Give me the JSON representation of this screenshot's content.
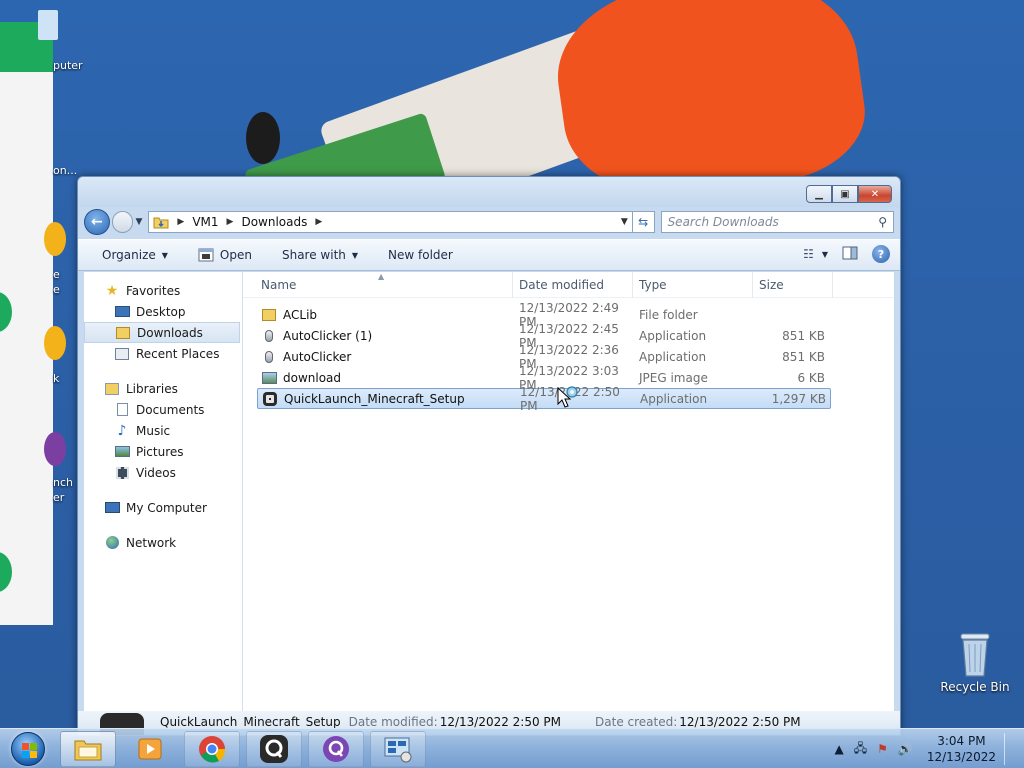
{
  "desktop": {
    "fragments": [
      "puter",
      "on...",
      "e",
      "e",
      "k",
      "nch",
      "er"
    ],
    "recycle_bin_label": "Recycle Bin"
  },
  "window": {
    "address": {
      "crumbs": [
        "VM1",
        "Downloads"
      ]
    },
    "search_placeholder": "Search Downloads",
    "toolbar": {
      "organize": "Organize",
      "open": "Open",
      "share_with": "Share with",
      "new_folder": "New folder"
    },
    "nav": {
      "favorites": {
        "label": "Favorites",
        "items": [
          "Desktop",
          "Downloads",
          "Recent Places"
        ]
      },
      "libraries": {
        "label": "Libraries",
        "items": [
          "Documents",
          "Music",
          "Pictures",
          "Videos"
        ]
      },
      "computer": "My Computer",
      "network": "Network"
    },
    "columns": {
      "name": "Name",
      "date": "Date modified",
      "type": "Type",
      "size": "Size"
    },
    "files": [
      {
        "name": "ACLib",
        "date": "12/13/2022 2:49 PM",
        "type": "File folder",
        "size": "",
        "icon": "folder-icon"
      },
      {
        "name": "AutoClicker (1)",
        "date": "12/13/2022 2:45 PM",
        "type": "Application",
        "size": "851 KB",
        "icon": "mouse-app-icon"
      },
      {
        "name": "AutoClicker",
        "date": "12/13/2022 2:36 PM",
        "type": "Application",
        "size": "851 KB",
        "icon": "mouse-app-icon"
      },
      {
        "name": "download",
        "date": "12/13/2022 3:03 PM",
        "type": "JPEG image",
        "size": "6 KB",
        "icon": "image-icon"
      },
      {
        "name": "QuickLaunch_Minecraft_Setup",
        "date": "12/13/2022 2:50 PM",
        "type": "Application",
        "size": "1,297 KB",
        "icon": "quicklaunch-icon"
      }
    ],
    "details": {
      "name": "QuickLaunch_Minecraft_Setup",
      "modified_label": "Date modified:",
      "modified_value": "12/13/2022 2:50 PM",
      "created_label": "Date created:",
      "created_value": "12/13/2022 2:50 PM"
    }
  },
  "taskbar": {
    "time": "3:04 PM",
    "date": "12/13/2022"
  },
  "colors": {
    "accent": "#2c69b5",
    "selection": "#c3dcf6",
    "close_button": "#c9452f"
  }
}
